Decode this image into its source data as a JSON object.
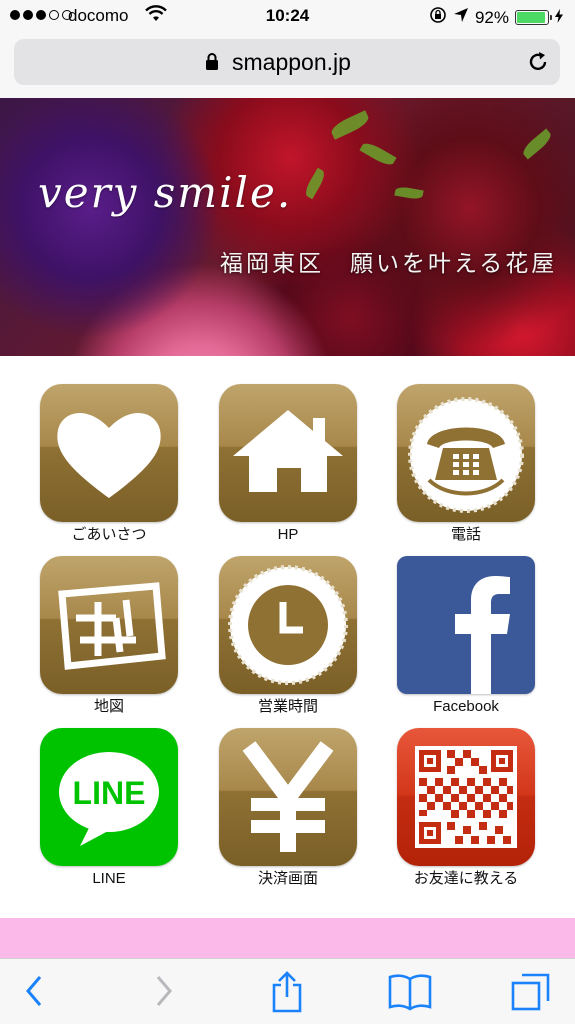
{
  "status_bar": {
    "carrier": "docomo",
    "time": "10:24",
    "battery": "92%",
    "battery_level": 0.92,
    "battery_color": "#4cd964",
    "signal_bars_filled": 3,
    "signal_bars_total": 5
  },
  "browser": {
    "domain": "smappon.jp",
    "icons": [
      "lock-icon",
      "reload-icon"
    ]
  },
  "hero": {
    "script_text": "very smile.",
    "tagline": "福岡東区　願いを叶える花屋"
  },
  "menu": {
    "items": [
      {
        "label": "ごあいさつ",
        "icon": "heart-icon",
        "color": "#a8884b"
      },
      {
        "label": "HP",
        "icon": "house-icon",
        "color": "#a8884b"
      },
      {
        "label": "電話",
        "icon": "telephone-icon",
        "color": "#a8884b"
      },
      {
        "label": "地図",
        "icon": "map-icon",
        "color": "#a8884b"
      },
      {
        "label": "営業時間",
        "icon": "clock-icon",
        "color": "#a8884b"
      },
      {
        "label": "Facebook",
        "icon": "facebook-icon",
        "color": "#3b5998"
      },
      {
        "label": "LINE",
        "icon": "line-icon",
        "color": "#00c300"
      },
      {
        "label": "決済画面",
        "icon": "yen-icon",
        "color": "#a8884b"
      },
      {
        "label": "お友達に教える",
        "icon": "qr-code-icon",
        "color": "#d2371a"
      }
    ],
    "line_bubble_text": "LINE"
  },
  "footer_band_color": "#fbb9ea",
  "toolbar": {
    "icons": [
      "back-icon",
      "forward-icon",
      "share-icon",
      "bookmarks-icon",
      "tabs-icon"
    ],
    "accent": "#1a82fb"
  }
}
